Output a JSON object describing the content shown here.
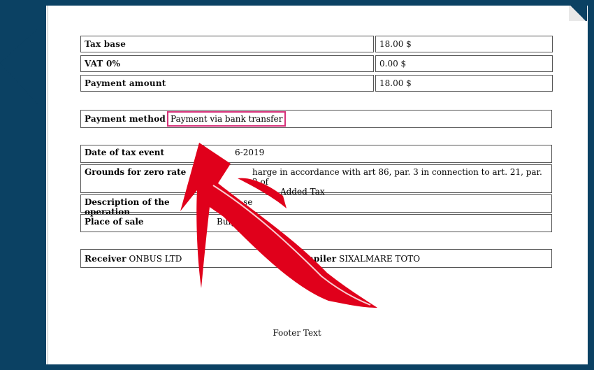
{
  "summary_rows": [
    {
      "label": "Tax base",
      "value": "18.00 $"
    },
    {
      "label": "VAT 0%",
      "value": "0.00 $"
    },
    {
      "label": "Payment amount",
      "value": "18.00 $"
    }
  ],
  "payment": {
    "label": "Payment method",
    "value": "Payment via bank transfer"
  },
  "details": [
    {
      "label": "Date of tax event",
      "value": "6-2019"
    },
    {
      "label": "Grounds for zero rate",
      "value": "harge in accordance with art 86, par. 3 in connection to art. 21, par. 2 of",
      "value2": "Added Tax"
    },
    {
      "label": "Description of the operation",
      "value": "Sal    e-se"
    },
    {
      "label": "Place of sale",
      "value": "Bulgar"
    }
  ],
  "receiver": {
    "label": "Receiver",
    "value": "ONBUS LTD"
  },
  "compiler": {
    "label": "Compiler",
    "value": "SIXALMARE TOTO"
  },
  "footer": "Footer Text",
  "colors": {
    "frame": "#0b4163",
    "highlight": "#d6327a",
    "arrow": "#e0001b"
  }
}
